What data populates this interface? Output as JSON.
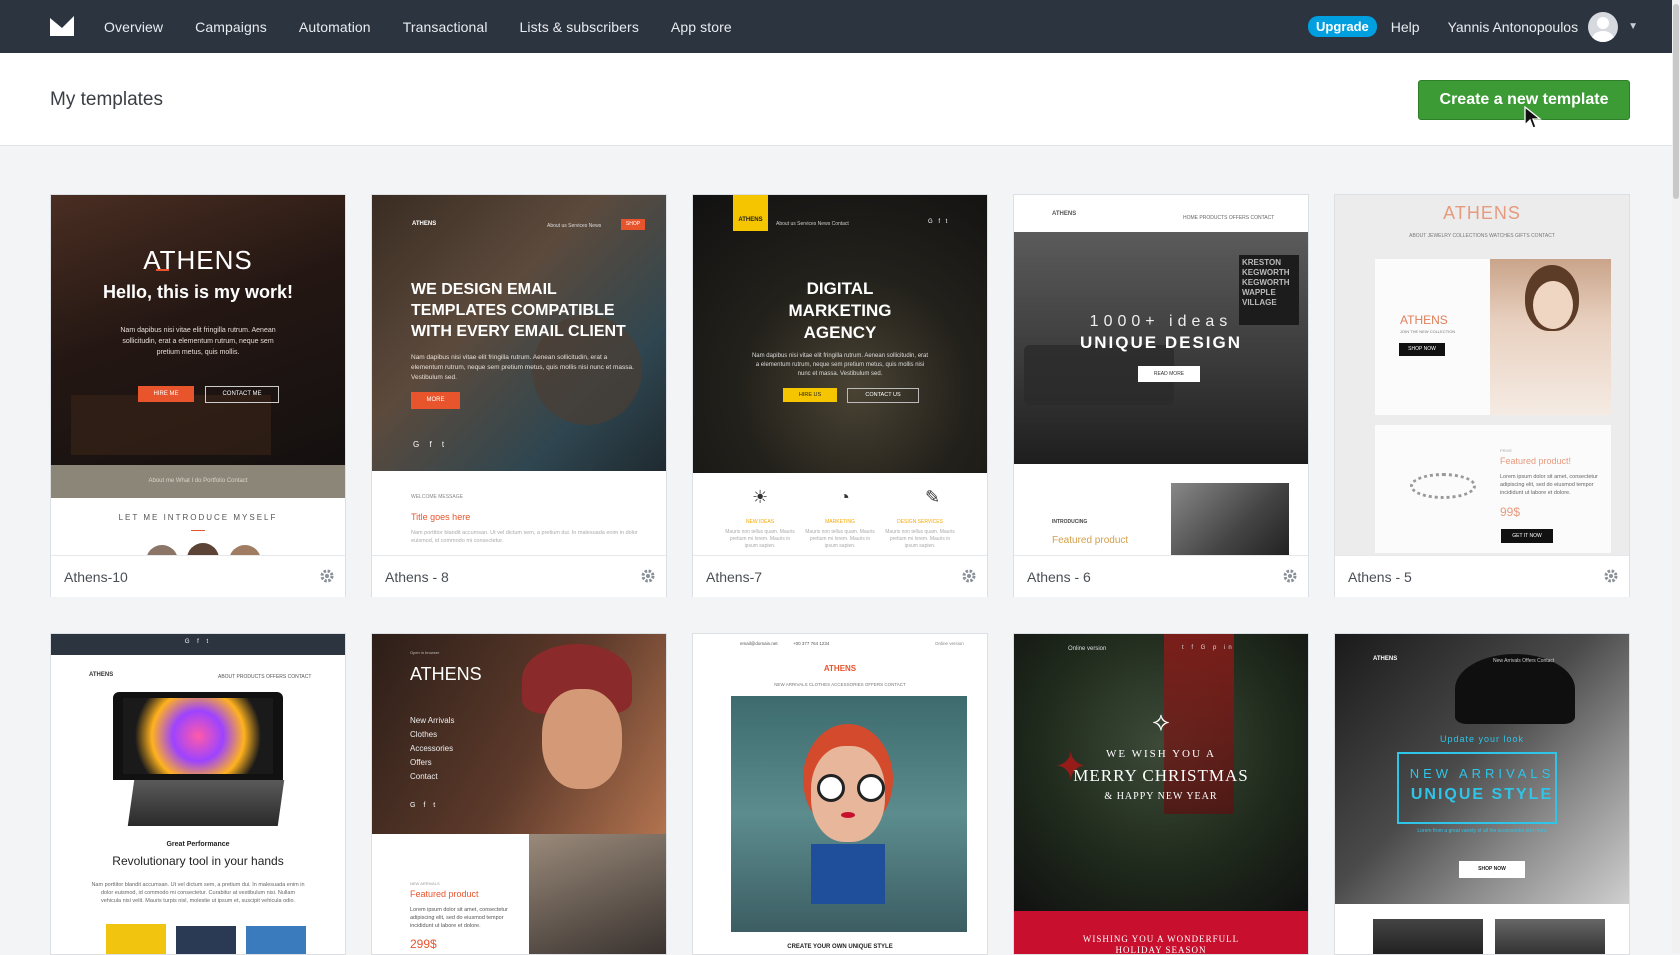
{
  "nav": {
    "items": [
      "Overview",
      "Campaigns",
      "Automation",
      "Transactional",
      "Lists & subscribers",
      "App store"
    ],
    "upgrade": "Upgrade",
    "help": "Help",
    "user": "Yannis Antonopoulos"
  },
  "header": {
    "title": "My templates",
    "create_label": "Create a new template"
  },
  "templates": [
    {
      "name": "Athens-10",
      "brand": "ATHENS",
      "headline": "Hello, this is my work!",
      "body": "Nam dapibus nisi vitae elit fringilla rutrum. Aenean sollicitudin, erat a elementum rutrum, neque sem pretium metus, quis mollis.",
      "btn1": "HIRE ME",
      "btn2": "CONTACT ME",
      "menu": "About me   What I do   Portfolio   Contact",
      "intro": "LET ME INTRODUCE MYSELF"
    },
    {
      "name": "Athens - 8",
      "brand": "ATHENS",
      "nav": "About us   Services   News",
      "nav_btn": "SHOP",
      "headline": "WE DESIGN EMAIL TEMPLATES COMPATIBLE WITH EVERY EMAIL CLIENT",
      "body": "Nam dapibus nisi vitae elit fringilla rutrum. Aenean sollicitudin, erat a elementum rutrum, neque sem pretium metus, quis mollis nisi nunc et massa. Vestibulum sed.",
      "btn": "MORE",
      "welcome": "WELCOME MESSAGE",
      "title": "Title goes here",
      "text": "Nam porttitor blandit accumsan. Ut vel dictum sem, a pretium dui. In malesuada enim in dolor euismod, id commodo mi consectetur."
    },
    {
      "name": "Athens-7",
      "brand": "ATHENS",
      "nav": "About us   Services   News   Contact",
      "headline": "DIGITAL MARKETING AGENCY",
      "body": "Nam dapibus nisi vitae elit fringilla rutrum. Aenean sollicitudin, erat a elementum rutrum, neque sem pretium metus, quis mollis nisi nunc et massa. Vestibulum sed.",
      "btn1": "HIRE US",
      "btn2": "CONTACT US",
      "features": [
        "NEW IDEAS",
        "MARKETING",
        "DESIGN SERVICES"
      ],
      "feature_text": "Mauris non tellus quam. Mauris pretium mi lorem. Mauris in ipsum sapien."
    },
    {
      "name": "Athens - 6",
      "brand": "ATHENS",
      "nav": "HOME   PRODUCTS   OFFERS   CONTACT",
      "line1": "1000+ ideas",
      "line2": "UNIQUE DESIGN",
      "btn": "READ MORE",
      "poster": "KRESTON KEGWORTH KEGWORTH WAPPLE VILLAGE",
      "label": "INTRODUCING",
      "featured": "Featured product"
    },
    {
      "name": "Athens - 5",
      "brand": "ATHENS",
      "nav": "ABOUT   JEWELRY   COLLECTIONS   WATCHES   GIFTS   CONTACT",
      "sub": "JOIN THE NEW COLLECTION",
      "btn": "SHOP NOW",
      "label": "PRIVE",
      "featured": "Featured product!",
      "text": "Lorem ipsum dolor sit amet, consectetur adipiscing elit, sed do eiusmod tempor incididunt ut labore et dolore.",
      "price": "99$",
      "btn2": "GET IT NOW"
    }
  ],
  "templates_row2": [
    {
      "brand": "ATHENS",
      "nav": "ABOUT   PRODUCTS   OFFERS   CONTACT",
      "kicker": "Great Performance",
      "headline": "Revolutionary tool in your hands",
      "body": "Nam porttitor blandit accumsan. Ut vel dictum sem, a pretium dui. In malesuada enim in dolor euismod, id commodo mi consectetur. Curabitur at vestibulum nisi. Nullam vehicula nisi velit. Mauris turpis nisl, molestie ut ipsum et, suscipit vehicula odio."
    },
    {
      "top": "Open in browser",
      "brand": "ATHENS",
      "menu": [
        "New Arrivals",
        "Clothes",
        "Accessories",
        "Offers",
        "Contact"
      ],
      "label": "NEW ARRIVALS",
      "featured": "Featured product",
      "text": "Lorem ipsum dolor sit amet, consectetur adipiscing elit, sed do eiusmod tempor incididunt ut labore et dolore.",
      "price": "299$"
    },
    {
      "email": "email@domain.net",
      "phone": "+00 377 764 1234",
      "top_right": "Online version",
      "brand": "ATHENS",
      "nav": "NEW ARRIVALS   CLOTHES   ACCESSORIES   OFFERS   CONTACT",
      "bottom": "CREATE YOUR OWN UNIQUE STYLE"
    },
    {
      "top": "Online version",
      "line1": "WE WISH YOU A",
      "line2": "MERRY CHRISTMAS",
      "line3": "& HAPPY NEW YEAR",
      "banner": "WISHING YOU A WONDERFULL HOLIDAY SEASON"
    },
    {
      "brand": "ATHENS",
      "nav": "New Arrivals   Offers   Contact",
      "kicker": "Update your look",
      "line1": "NEW ARRIVALS",
      "line2": "UNIQUE STYLE",
      "sub": "Lorem from a great variety of all the accessories and more",
      "btn": "SHOP NOW"
    }
  ],
  "colors": {
    "topbar": "#2c3440",
    "upgrade": "#00a0e0",
    "create_button": "#3c9b35",
    "accent_orange": "#e8552d",
    "accent_yellow": "#f5c500"
  },
  "icons": [
    "logo-icon",
    "gear-icon",
    "cursor-icon",
    "chevron-down-icon"
  ]
}
